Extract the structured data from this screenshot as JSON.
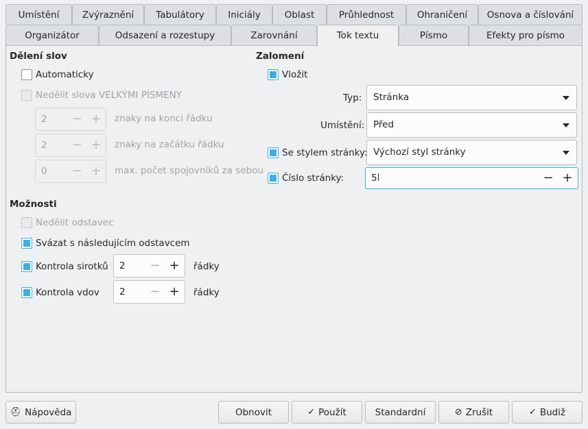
{
  "tabs_row1": [
    "Umístění",
    "Zvýraznění",
    "Tabulátory",
    "Iniciály",
    "Oblast",
    "Průhlednost",
    "Ohraničení",
    "Osnova a číslování"
  ],
  "tabs_row2": [
    "Organizátor",
    "Odsazení a rozestupy",
    "Zarovnání",
    "Tok textu",
    "Písmo",
    "Efekty pro písmo"
  ],
  "active_tab": "Tok textu",
  "hyphenation": {
    "title": "Dělení slov",
    "automatic": {
      "label": "Automaticky",
      "checked": false
    },
    "no_caps": {
      "label": "Nedělit slova VELKÝMI PÍSMENY",
      "checked": false,
      "disabled": true
    },
    "end_chars": {
      "value": "2",
      "label": "znaky na konci řádku"
    },
    "start_chars": {
      "value": "2",
      "label": "znaky na začátku řádku"
    },
    "max_hyphens": {
      "value": "0",
      "label": "max. počet spojovníků za sebou"
    }
  },
  "options": {
    "title": "Možnosti",
    "no_split": {
      "label": "Nedělit odstavec",
      "checked": false,
      "disabled": true
    },
    "keep_next": {
      "label": "Svázat s následujícím odstavcem",
      "checked": true
    },
    "orphan": {
      "label": "Kontrola sirotků",
      "checked": true,
      "value": "2",
      "unit": "řádky"
    },
    "widow": {
      "label": "Kontrola vdov",
      "checked": true,
      "value": "2",
      "unit": "řádky"
    }
  },
  "breaks": {
    "title": "Zalomení",
    "insert": {
      "label": "Vložit",
      "checked": true
    },
    "type": {
      "label": "Typ:",
      "value": "Stránka"
    },
    "position": {
      "label": "Umístění:",
      "value": "Před"
    },
    "page_style": {
      "label": "Se stylem stránky:",
      "checked": true,
      "value": "Výchozí styl stránky"
    },
    "page_number": {
      "label": "Číslo stránky:",
      "checked": true,
      "value": "5"
    }
  },
  "buttons": {
    "help": "Nápověda",
    "reset": "Obnovit",
    "apply": "Použít",
    "standard": "Standardní",
    "cancel": "Zrušit",
    "ok": "Budiž"
  },
  "colors": {
    "accent": "#3daee9",
    "background": "#eff0f1"
  }
}
